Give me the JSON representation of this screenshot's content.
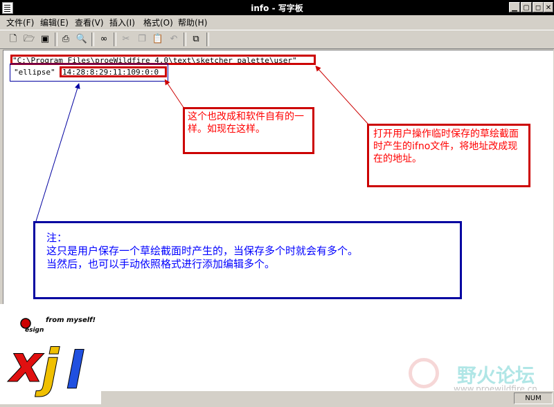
{
  "window": {
    "title": "info - 写字板"
  },
  "menu": [
    "文件(F)",
    "编辑(E)",
    "查看(V)",
    "插入(I)",
    "格式(O)",
    "帮助(H)"
  ],
  "document": {
    "line1": "\"C:\\Program Files\\proeWildfire 4.0\\text\\sketcher_palette\\user\"",
    "line2_name": "\"ellipse\"",
    "line2_values": "14:28:8:29:11:109:0:0"
  },
  "annotations": {
    "middle": "这个也改成和软件自有的一样。如现在这样。",
    "right": "打开用户操作临时保存的草绘截面时产生的ifno文件，将地址改成现在的地址。",
    "note_title": "注：",
    "note_line1": "这只是用户保存一个草绘截面时产生的，当保存多个时就会有多个。",
    "note_line2": "当然后，也可以手动依照格式进行添加编辑多个。"
  },
  "logo": {
    "tagline": "from myself!",
    "word": "esign",
    "letters": "xjl"
  },
  "watermark": {
    "name": "野火论坛",
    "url": "www.proewildfire.cn"
  },
  "status": {
    "num": "NUM"
  },
  "colors": {
    "annotation_red": "#ff0000",
    "annotation_blue": "#0000ff",
    "box_blue": "#0000a0",
    "box_red": "#cc0000"
  }
}
